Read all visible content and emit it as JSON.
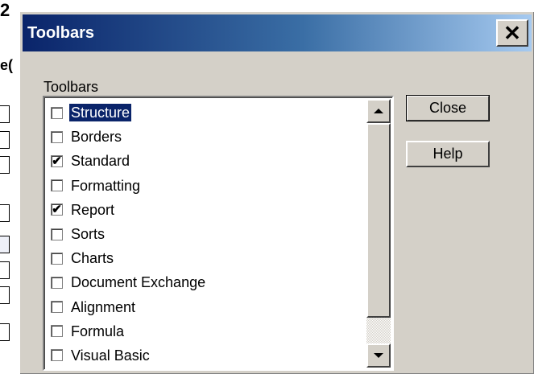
{
  "background_fragments": {
    "glyph_top": "2",
    "glyph_second": "e("
  },
  "dialog": {
    "title": "Toolbars",
    "close_glyph": "✕",
    "group_label": "Toolbars",
    "items": [
      {
        "label": "Structure",
        "checked": false,
        "selected": true
      },
      {
        "label": "Borders",
        "checked": false,
        "selected": false
      },
      {
        "label": "Standard",
        "checked": true,
        "selected": false
      },
      {
        "label": "Formatting",
        "checked": false,
        "selected": false
      },
      {
        "label": "Report",
        "checked": true,
        "selected": false
      },
      {
        "label": "Sorts",
        "checked": false,
        "selected": false
      },
      {
        "label": "Charts",
        "checked": false,
        "selected": false
      },
      {
        "label": "Document Exchange",
        "checked": false,
        "selected": false
      },
      {
        "label": "Alignment",
        "checked": false,
        "selected": false
      },
      {
        "label": "Formula",
        "checked": false,
        "selected": false
      },
      {
        "label": "Visual Basic",
        "checked": false,
        "selected": false
      }
    ],
    "buttons": {
      "close_label": "Close",
      "help_label": "Help"
    }
  },
  "colors": {
    "title_bar_start": "#0a246a",
    "selection": "#0a246a",
    "face": "#d4d0c8"
  }
}
